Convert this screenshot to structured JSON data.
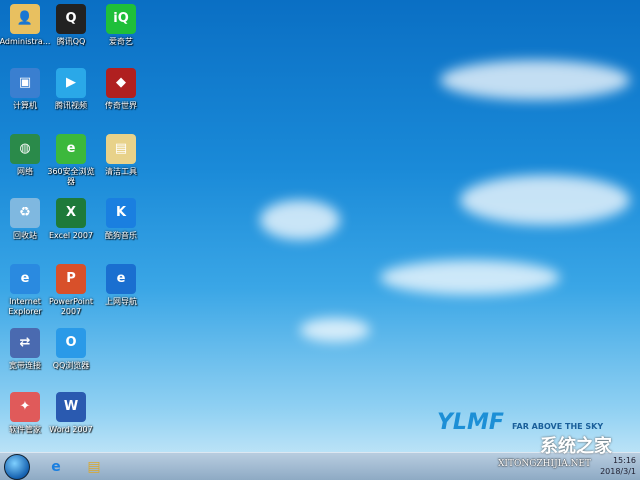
{
  "desktop": {
    "icons": [
      {
        "label": "Administra...",
        "icon": "user-folder-icon",
        "color": "#e8c060",
        "ch": "👤",
        "col": 0,
        "row": 0
      },
      {
        "label": "腾讯QQ",
        "icon": "qq-penguin-icon",
        "color": "#222222",
        "ch": "Q",
        "col": 1,
        "row": 0
      },
      {
        "label": "爱奇艺",
        "icon": "iqiyi-icon",
        "color": "#1fbf3a",
        "ch": "iQ",
        "col": 2,
        "row": 0
      },
      {
        "label": "计算机",
        "icon": "computer-icon",
        "color": "#3a7fd0",
        "ch": "▣",
        "col": 0,
        "row": 1
      },
      {
        "label": "腾讯视频",
        "icon": "tencent-video-icon",
        "color": "#2aa8e8",
        "ch": "▶",
        "col": 1,
        "row": 1
      },
      {
        "label": "传奇世界",
        "icon": "game-icon",
        "color": "#b02020",
        "ch": "◆",
        "col": 2,
        "row": 1
      },
      {
        "label": "网络",
        "icon": "network-globe-icon",
        "color": "#2a8a4a",
        "ch": "◍",
        "col": 0,
        "row": 2
      },
      {
        "label": "360安全浏览器",
        "icon": "browser-360-icon",
        "color": "#3cb83c",
        "ch": "e",
        "col": 1,
        "row": 2
      },
      {
        "label": "清洁工具",
        "icon": "folder-icon",
        "color": "#e8d28a",
        "ch": "▤",
        "col": 2,
        "row": 2
      },
      {
        "label": "回收站",
        "icon": "recycle-bin-icon",
        "color": "#7fb8e0",
        "ch": "♻",
        "col": 0,
        "row": 3
      },
      {
        "label": "Excel 2007",
        "icon": "excel-icon",
        "color": "#1e7a3a",
        "ch": "X",
        "col": 1,
        "row": 3
      },
      {
        "label": "酷狗音乐",
        "icon": "kugou-icon",
        "color": "#1a7fe0",
        "ch": "K",
        "col": 2,
        "row": 3
      },
      {
        "label": "Internet Explorer",
        "icon": "internet-explorer-icon",
        "color": "#2a8ae0",
        "ch": "e",
        "col": 0,
        "row": 4
      },
      {
        "label": "PowerPoint 2007",
        "icon": "powerpoint-icon",
        "color": "#d8502a",
        "ch": "P",
        "col": 1,
        "row": 4
      },
      {
        "label": "上网导航",
        "icon": "edge-browser-icon",
        "color": "#1a6fd0",
        "ch": "e",
        "col": 2,
        "row": 4
      },
      {
        "label": "宽带连接",
        "icon": "broadband-connection-icon",
        "color": "#4a6ab0",
        "ch": "⇄",
        "col": 0,
        "row": 5
      },
      {
        "label": "QQ浏览器",
        "icon": "qq-browser-icon",
        "color": "#2a9ae8",
        "ch": "O",
        "col": 1,
        "row": 5
      },
      {
        "label": "软件管家",
        "icon": "software-manager-icon",
        "color": "#e05a5a",
        "ch": "✦",
        "col": 0,
        "row": 6
      },
      {
        "label": "Word 2007",
        "icon": "word-icon",
        "color": "#2a5ab0",
        "ch": "W",
        "col": 1,
        "row": 6
      }
    ]
  },
  "wallpaper": {
    "logo": "YLMF",
    "slogan": "FAR ABOVE THE SKY"
  },
  "watermark": {
    "text": "系统之家",
    "url_text": "XITONGZHIJIA.NET"
  },
  "taskbar": {
    "time": "15:16",
    "date": "2018/3/1"
  }
}
